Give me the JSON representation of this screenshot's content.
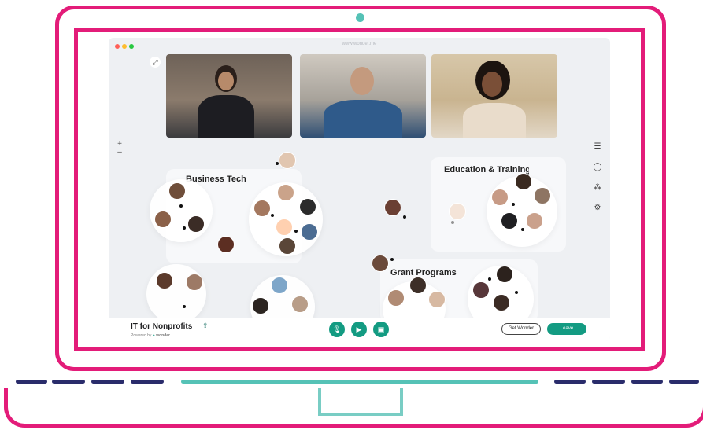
{
  "browser": {
    "url": "www.wonder.me"
  },
  "zoom": {
    "in_label": "+",
    "out_label": "–"
  },
  "rooms": [
    {
      "title": "Business Tech"
    },
    {
      "title": "Education & Training"
    },
    {
      "title": "Grant Programs"
    }
  ],
  "space": {
    "name": "IT for Nonprofits",
    "powered_by": "Powered by",
    "brand": "wonder"
  },
  "actions": {
    "get_wonder": "Get Wonder",
    "leave": "Leave"
  },
  "icons": {
    "expand": "expand-icon",
    "list": "list-icon",
    "chat": "chat-icon",
    "network": "network-icon",
    "settings": "gear-icon",
    "share": "share-icon",
    "mic": "microphone-icon",
    "camera": "camera-icon",
    "screen": "screen-share-icon"
  },
  "colors": {
    "frame": "#e31c79",
    "accent_teal": "#139b82",
    "hinge_navy": "#2a2c6b",
    "hinge_teal": "#55c2b6"
  }
}
